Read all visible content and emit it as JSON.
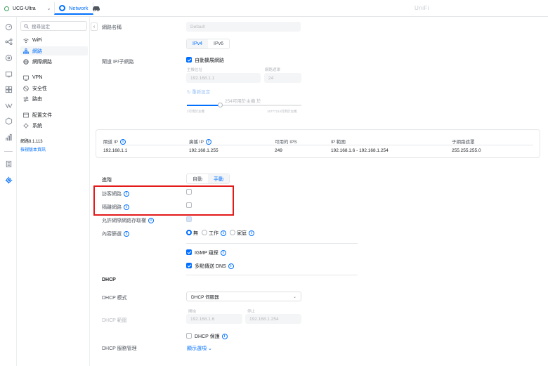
{
  "topbar": {
    "device_name": "UCG-Ultra",
    "active_tab": "Network",
    "brand": "UniFi"
  },
  "sidebar": {
    "search_placeholder": "搜尋設定",
    "items": [
      {
        "label": "WiFi",
        "icon": "wifi-icon",
        "active": false
      },
      {
        "label": "網路",
        "icon": "network-topology-icon",
        "active": true
      },
      {
        "label": "網際網路",
        "icon": "globe-icon",
        "active": false
      },
      {
        "label": "VPN",
        "icon": "vpn-icon",
        "active": false
      },
      {
        "label": "安全性",
        "icon": "shield-icon",
        "active": false
      },
      {
        "label": "路由",
        "icon": "routing-icon",
        "active": false
      },
      {
        "label": "配置文件",
        "icon": "document-icon",
        "active": false
      },
      {
        "label": "系統",
        "icon": "gear-icon",
        "active": false
      }
    ],
    "version": "網路8.1.113",
    "release_notes_link": "檢視版本資訊"
  },
  "form": {
    "network_name_label": "網路名稱",
    "network_name_placeholder": "Default",
    "ip_tabs": [
      "IPv4",
      "IPv6"
    ],
    "gateway_label": "閘道 IP/子網路",
    "auto_scale_label": "自動擴展網路",
    "host_address_label": "主機位址",
    "host_address_value": "192.168.1.1",
    "netmask_label": "網路遮罩",
    "netmask_value": "24",
    "reset_link": "重新設定",
    "slider_caption": "254可用於主機 於",
    "slider_min_caption": "2可用於主機",
    "slider_max_caption": "16777214可用於主機",
    "table": {
      "headers": [
        "閘道 IP",
        "廣播 IP",
        "可用的 IPS",
        "IP 範圍",
        "子網路遮罩"
      ],
      "row": [
        "192.168.1.1",
        "192.168.1.255",
        "249",
        "192.168.1.6 - 192.168.1.254",
        "255.255.255.0"
      ]
    },
    "advanced_label": "進階",
    "mode_tabs": [
      "自動",
      "手動"
    ],
    "guest_network_label": "訪客網路",
    "isolate_network_label": "隔離網路",
    "allow_internet_label": "允許網際網路存取權",
    "content_filter_label": "內容篩選",
    "content_filter_options": [
      "無",
      "工作",
      "家庭"
    ],
    "igmp_label": "IGMP 窺探",
    "multicast_dns_label": "多點傳送 DNS",
    "dhcp_section": "DHCP",
    "dhcp_mode_label": "DHCP 模式",
    "dhcp_mode_value": "DHCP 伺服器",
    "dhcp_range_label": "DHCP 範圍",
    "range_start_label": "開始",
    "range_start_value": "192.168.1.6",
    "range_stop_label": "停止",
    "range_stop_value": "192.168.1.254",
    "dhcp_guard_label": "DHCP 保護",
    "dhcp_service_label": "DHCP 服務管理",
    "show_options_link": "顯示選項"
  },
  "colors": {
    "accent": "#006fff",
    "highlight_box": "#e21a1a",
    "online": "#38a05d"
  }
}
